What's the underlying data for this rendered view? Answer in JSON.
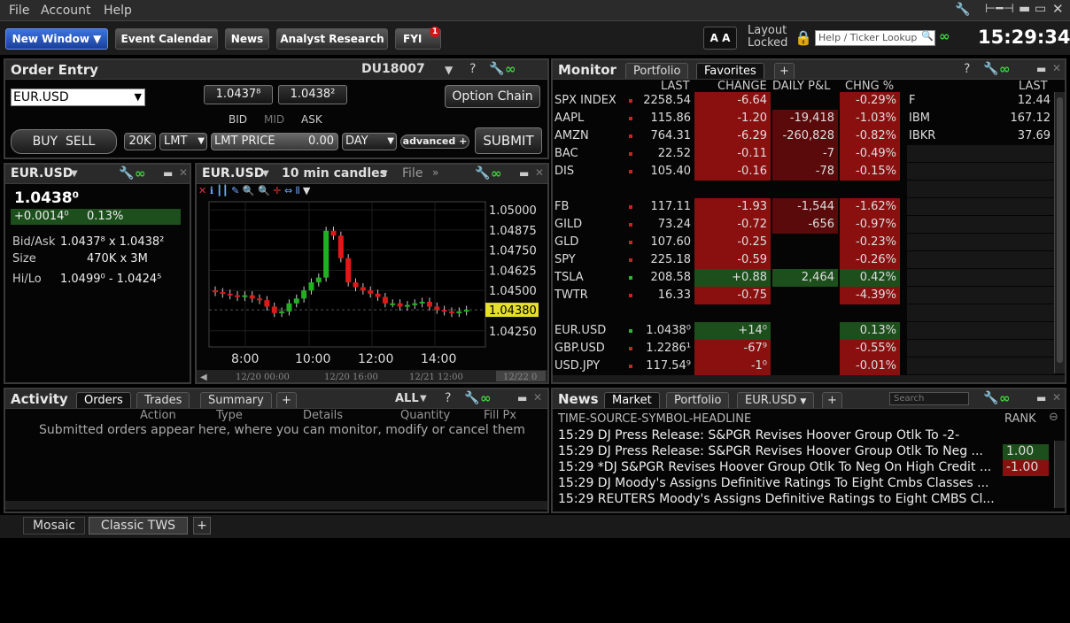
{
  "menu": {
    "file": "File",
    "account": "Account",
    "help": "Help"
  },
  "toolbar": {
    "new_window": "New Window",
    "event_calendar": "Event Calendar",
    "news": "News",
    "analyst_research": "Analyst Research",
    "fyi": "FYI",
    "fyi_badge": "1",
    "font_btn": "A A",
    "layout": "Layout",
    "locked": "Locked",
    "search_placeholder": "Help / Ticker Lookup",
    "clock": "15:29:34"
  },
  "order_entry": {
    "title": "Order Entry",
    "account": "DU18007",
    "symbol": "EUR.USD",
    "bid": "1.0437⁸",
    "ask": "1.0438²",
    "bid_label": "BID",
    "mid_label": "MID",
    "ask_label": "ASK",
    "option_chain": "Option Chain",
    "buy": "BUY",
    "sell": "SELL",
    "qty": "20K",
    "type": "LMT",
    "price_label": "LMT PRICE",
    "price": "0.00",
    "tif": "DAY",
    "advanced": "advanced",
    "submit": "SUBMIT"
  },
  "quote": {
    "symbol": "EUR.USD",
    "last": "1.0438⁰",
    "change": "+0.0014⁰",
    "change_pct": "0.13%",
    "bidask_label": "Bid/Ask",
    "bidask": "1.0437⁸ x 1.0438²",
    "size_label": "Size",
    "size": "470K x 3M",
    "hilo_label": "Hi/Lo",
    "hilo": "1.0499⁰ - 1.0424⁵"
  },
  "chart": {
    "symbol": "EUR.USD",
    "interval": "10 min candles",
    "file": "File",
    "last_label": "1.04380",
    "yticks": [
      "1.05000",
      "1.04875",
      "1.04750",
      "1.04625",
      "1.04500",
      "1.04250"
    ],
    "xticks": [
      "8:00",
      "10:00",
      "12:00",
      "14:00"
    ],
    "dates": [
      "12/20 00:00",
      "12/20 16:00",
      "12/21 12:00",
      "12/22 0"
    ]
  },
  "chart_data": {
    "type": "candlestick",
    "title": "",
    "ylim": [
      1.0415,
      1.0505
    ],
    "x": [
      "8:00",
      "10:00",
      "12:00",
      "14:00"
    ],
    "close_last": 1.0438,
    "series": [
      {
        "values": [
          1.0449,
          1.0448,
          1.0447,
          1.0446,
          1.0447,
          1.0445,
          1.0444,
          1.044,
          1.0436,
          1.0437,
          1.0442,
          1.0445,
          1.045,
          1.0455,
          1.0458,
          1.0487,
          1.0484,
          1.047,
          1.0455,
          1.0452,
          1.045,
          1.0448,
          1.0446,
          1.0442,
          1.0442,
          1.044,
          1.0441,
          1.0442,
          1.0443,
          1.044,
          1.0438,
          1.0437,
          1.0436,
          1.0437,
          1.0438
        ]
      }
    ]
  },
  "monitor": {
    "title": "Monitor",
    "tabs": [
      "Portfolio",
      "Favorites"
    ],
    "headers": {
      "last": "LAST",
      "change": "CHANGE",
      "pnl": "DAILY P&L",
      "pct": "CHNG %"
    },
    "rows": [
      {
        "sym": "SPX INDEX",
        "last": "2258.54",
        "chg": "-6.64",
        "pnl": "",
        "pct": "-0.29%"
      },
      {
        "sym": "AAPL",
        "last": "115.86",
        "chg": "-1.20",
        "pnl": "-19,418",
        "pct": "-1.03%"
      },
      {
        "sym": "AMZN",
        "last": "764.31",
        "chg": "-6.29",
        "pnl": "-260,828",
        "pct": "-0.82%"
      },
      {
        "sym": "BAC",
        "last": "22.52",
        "chg": "-0.11",
        "pnl": "-7",
        "pct": "-0.49%"
      },
      {
        "sym": "DIS",
        "last": "105.40",
        "chg": "-0.16",
        "pnl": "-78",
        "pct": "-0.15%"
      },
      {
        "sym": "",
        "last": "",
        "chg": "",
        "pnl": "",
        "pct": ""
      },
      {
        "sym": "FB",
        "last": "117.11",
        "chg": "-1.93",
        "pnl": "-1,544",
        "pct": "-1.62%"
      },
      {
        "sym": "GILD",
        "last": "73.24",
        "chg": "-0.72",
        "pnl": "-656",
        "pct": "-0.97%"
      },
      {
        "sym": "GLD",
        "last": "107.60",
        "chg": "-0.25",
        "pnl": "",
        "pct": "-0.23%"
      },
      {
        "sym": "SPY",
        "last": "225.18",
        "chg": "-0.59",
        "pnl": "",
        "pct": "-0.26%"
      },
      {
        "sym": "TSLA",
        "last": "208.58",
        "chg": "+0.88",
        "pnl": "2,464",
        "pct": "0.42%"
      },
      {
        "sym": "TWTR",
        "last": "16.33",
        "chg": "-0.75",
        "pnl": "",
        "pct": "-4.39%"
      },
      {
        "sym": "",
        "last": "",
        "chg": "",
        "pnl": "",
        "pct": ""
      },
      {
        "sym": "EUR.USD",
        "last": "1.0438⁰",
        "chg": "+14⁰",
        "pnl": "",
        "pct": "0.13%"
      },
      {
        "sym": "GBP.USD",
        "last": "1.2286¹",
        "chg": "-67⁹",
        "pnl": "",
        "pct": "-0.55%"
      },
      {
        "sym": "USD.JPY",
        "last": "117.54⁹",
        "chg": "-1⁰",
        "pnl": "",
        "pct": "-0.01%"
      }
    ],
    "right_header": "LAST",
    "right_rows": [
      {
        "sym": "F",
        "last": "12.44"
      },
      {
        "sym": "IBM",
        "last": "167.12"
      },
      {
        "sym": "IBKR",
        "last": "37.69"
      }
    ]
  },
  "activity": {
    "title": "Activity",
    "tabs": [
      "Orders",
      "Trades",
      "Summary"
    ],
    "filter": "ALL",
    "cols": [
      "Action",
      "Type",
      "Details",
      "Quantity",
      "Fill Px"
    ],
    "empty": "Submitted orders appear here, where you can monitor, modify or cancel them"
  },
  "news": {
    "title": "News",
    "tabs": [
      "Market",
      "Portfolio",
      "EUR.USD"
    ],
    "search_placeholder": "Search",
    "header": "TIME-SOURCE-SYMBOL-HEADLINE",
    "rank_header": "RANK",
    "items": [
      {
        "text": "15:29 DJ Press Release: S&PGR Revises Hoover Group Otlk To -2-",
        "rank": ""
      },
      {
        "text": "15:29 DJ Press Release: S&PGR Revises Hoover Group Otlk To Neg ...",
        "rank": "1.00"
      },
      {
        "text": "15:29 *DJ S&PGR Revises Hoover Group Otlk To Neg On High Credit ...",
        "rank": "-1.00"
      },
      {
        "text": "15:29 DJ Moody's Assigns Definitive Ratings To Eight Cmbs Classes ...",
        "rank": ""
      },
      {
        "text": "15:29 REUTERS Moody's Assigns Definitive Ratings to Eight CMBS Cl...",
        "rank": ""
      }
    ]
  },
  "bottom_tabs": [
    "Mosaic",
    "Classic TWS"
  ],
  "colors": {
    "red": "#8a1010",
    "green": "#1c4f1c",
    "accent": "#2d5fd0"
  }
}
